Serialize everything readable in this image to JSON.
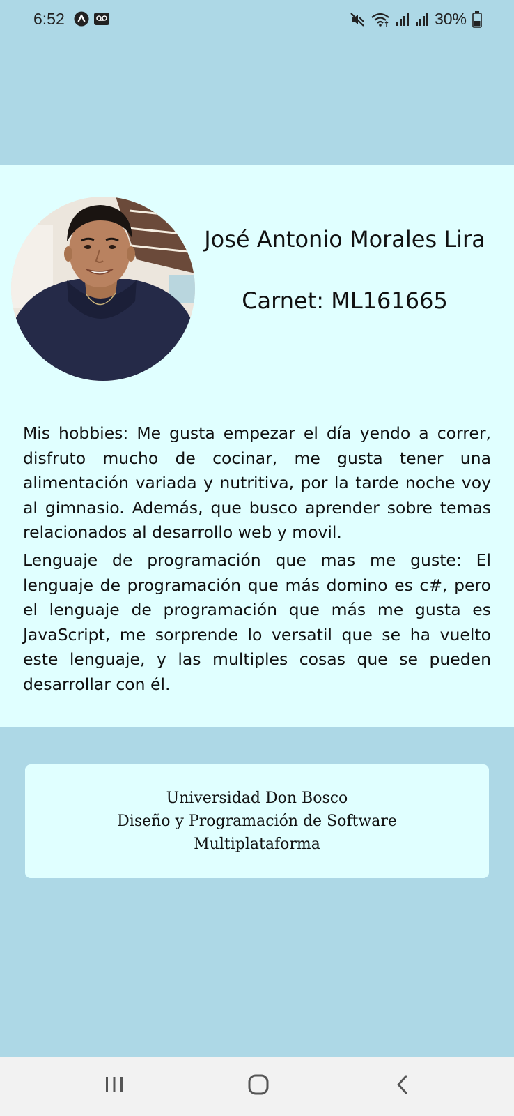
{
  "status_bar": {
    "time": "6:52",
    "battery": "30%",
    "icons": [
      "app-notification-icon",
      "voicemail-icon",
      "mute-icon",
      "wifi-icon",
      "signal-icon",
      "signal-icon",
      "battery-icon"
    ]
  },
  "profile": {
    "name": "José Antonio Morales Lira",
    "carnet": "Carnet: ML161665",
    "hobbies": "Mis hobbies: Me gusta empezar el día yendo a correr, disfruto mucho de cocinar, me gusta tener una alimentación variada y nutritiva, por la tarde noche voy al gimnasio. Además, que busco aprender sobre temas relacionados al desarrollo web y movil.",
    "language": "Lenguaje de programación que mas me guste: El lenguaje de programación que más domino es c#, pero el lenguaje de programación que más me gusta es JavaScript, me sorprende lo versatil que se ha vuelto este lenguaje, y las multiples cosas que se pueden desarrollar con él."
  },
  "footer": {
    "line1": "Universidad Don Bosco",
    "line2": "Diseño y Programación de Software",
    "line3": "Multiplataforma"
  },
  "nav": {
    "icons": [
      "recents-icon",
      "home-icon",
      "back-icon"
    ]
  },
  "colors": {
    "background": "#add8e6",
    "panel": "#e0ffff",
    "nav_bar": "#f2f2f2"
  }
}
